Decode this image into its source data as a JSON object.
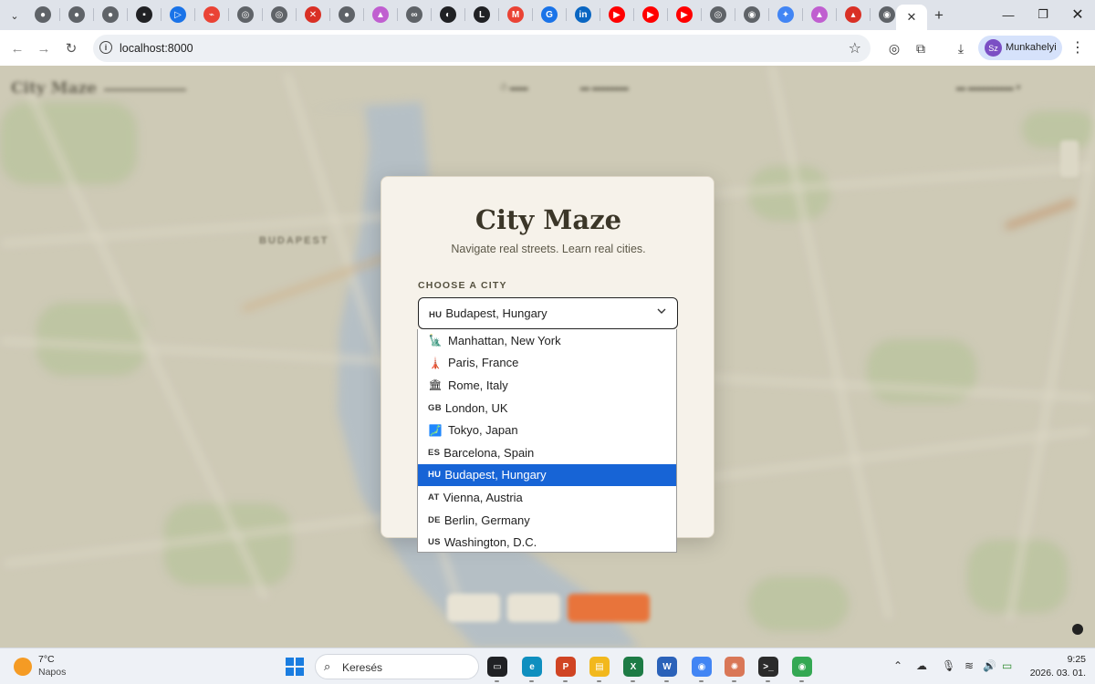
{
  "browser": {
    "url": "localhost:8000",
    "profile_name": "Munkahelyi",
    "profile_initials": "Sz",
    "pinned_tabs": [
      {
        "icon": "globe-icon",
        "glyph": "●",
        "color": "#5f6368"
      },
      {
        "icon": "globe-icon",
        "glyph": "●",
        "color": "#5f6368"
      },
      {
        "icon": "globe-icon",
        "glyph": "●",
        "color": "#5f6368"
      },
      {
        "icon": "app-dark-icon",
        "glyph": "▪",
        "color": "#202124"
      },
      {
        "icon": "play-arrow-icon",
        "glyph": "▷",
        "color": "#1a73e8"
      },
      {
        "icon": "chart-icon",
        "glyph": "⌁",
        "color": "#ea4335"
      },
      {
        "icon": "openai-icon",
        "glyph": "◎",
        "color": "#5f6368"
      },
      {
        "icon": "openai-icon",
        "glyph": "◎",
        "color": "#5f6368"
      },
      {
        "icon": "compass-icon",
        "glyph": "✕",
        "color": "#d93025"
      },
      {
        "icon": "globe-icon",
        "glyph": "●",
        "color": "#5f6368"
      },
      {
        "icon": "claude-icon",
        "glyph": "▲",
        "color": "#c05fd0"
      },
      {
        "icon": "glasses-icon",
        "glyph": "∞",
        "color": "#5f6368"
      },
      {
        "icon": "moon-icon",
        "glyph": "◐",
        "color": "#202124"
      },
      {
        "icon": "letter-l-icon",
        "glyph": "L",
        "color": "#202124"
      },
      {
        "icon": "gmail-icon",
        "glyph": "M",
        "color": "#ea4335"
      },
      {
        "icon": "grammarly-icon",
        "glyph": "G",
        "color": "#1a73e8"
      },
      {
        "icon": "linkedin-icon",
        "glyph": "in",
        "color": "#0a66c2"
      },
      {
        "icon": "youtube-icon",
        "glyph": "▶",
        "color": "#ff0000"
      },
      {
        "icon": "youtube-icon",
        "glyph": "▶",
        "color": "#ff0000"
      },
      {
        "icon": "youtube-icon",
        "glyph": "▶",
        "color": "#ff0000"
      },
      {
        "icon": "openai-icon",
        "glyph": "◎",
        "color": "#5f6368"
      },
      {
        "icon": "chrome-icon",
        "glyph": "◉",
        "color": "#5f6368"
      },
      {
        "icon": "gemini-icon",
        "glyph": "✦",
        "color": "#4285f4"
      },
      {
        "icon": "claude-icon",
        "glyph": "▲",
        "color": "#c05fd0"
      },
      {
        "icon": "flag-icon",
        "glyph": "▴",
        "color": "#d93025"
      },
      {
        "icon": "chrome-icon",
        "glyph": "◉",
        "color": "#5f6368"
      }
    ]
  },
  "page": {
    "app_name": "City Maze",
    "modal": {
      "title": "City Maze",
      "subtitle": "Navigate real streets. Learn real cities.",
      "choose_label": "CHOOSE A CITY",
      "selected_code": "HU",
      "selected_value": "Budapest, Hungary"
    },
    "cities": [
      {
        "code": "",
        "icon": "statue-of-liberty-icon",
        "glyph": "🗽",
        "label": "Manhattan, New York",
        "selected": false
      },
      {
        "code": "",
        "icon": "eiffel-tower-icon",
        "glyph": "🗼",
        "label": "Paris, France",
        "selected": false
      },
      {
        "code": "",
        "icon": "colosseum-icon",
        "glyph": "🏛",
        "label": "Rome, Italy",
        "selected": false
      },
      {
        "code": "GB",
        "icon": "",
        "glyph": "",
        "label": "London, UK",
        "selected": false
      },
      {
        "code": "",
        "icon": "japan-map-icon",
        "glyph": "🗾",
        "label": "Tokyo, Japan",
        "selected": false
      },
      {
        "code": "ES",
        "icon": "",
        "glyph": "",
        "label": "Barcelona, Spain",
        "selected": false
      },
      {
        "code": "HU",
        "icon": "",
        "glyph": "",
        "label": "Budapest, Hungary",
        "selected": true
      },
      {
        "code": "AT",
        "icon": "",
        "glyph": "",
        "label": "Vienna, Austria",
        "selected": false
      },
      {
        "code": "DE",
        "icon": "",
        "glyph": "",
        "label": "Berlin, Germany",
        "selected": false
      },
      {
        "code": "US",
        "icon": "",
        "glyph": "",
        "label": "Washington, D.C.",
        "selected": false
      }
    ],
    "colors": {
      "accent_select": "#1764d6",
      "modal_bg": "#f6f2ea",
      "title_color": "#3b3628",
      "cta_orange": "#e8743b"
    }
  },
  "taskbar": {
    "temperature": "7°C",
    "weather": "Napos",
    "search_placeholder": "Keresés",
    "time": "9:25",
    "date": "2026. 03. 01.",
    "apps": [
      {
        "icon": "task-view-icon",
        "glyph": "▭",
        "color": "#202124"
      },
      {
        "icon": "edge-icon",
        "glyph": "e",
        "color": "#0f8fbf"
      },
      {
        "icon": "powerpoint-icon",
        "glyph": "P",
        "color": "#d04423"
      },
      {
        "icon": "file-explorer-icon",
        "glyph": "▤",
        "color": "#f2b81d"
      },
      {
        "icon": "excel-icon",
        "glyph": "X",
        "color": "#1d7b45"
      },
      {
        "icon": "word-icon",
        "glyph": "W",
        "color": "#2b62b9"
      },
      {
        "icon": "chrome-icon",
        "glyph": "◉",
        "color": "#4285f4"
      },
      {
        "icon": "claude-app-icon",
        "glyph": "✺",
        "color": "#d97757"
      },
      {
        "icon": "terminal-icon",
        "glyph": ">_",
        "color": "#2b2b2b"
      },
      {
        "icon": "chrome-icon",
        "glyph": "◉",
        "color": "#34a853"
      }
    ]
  }
}
